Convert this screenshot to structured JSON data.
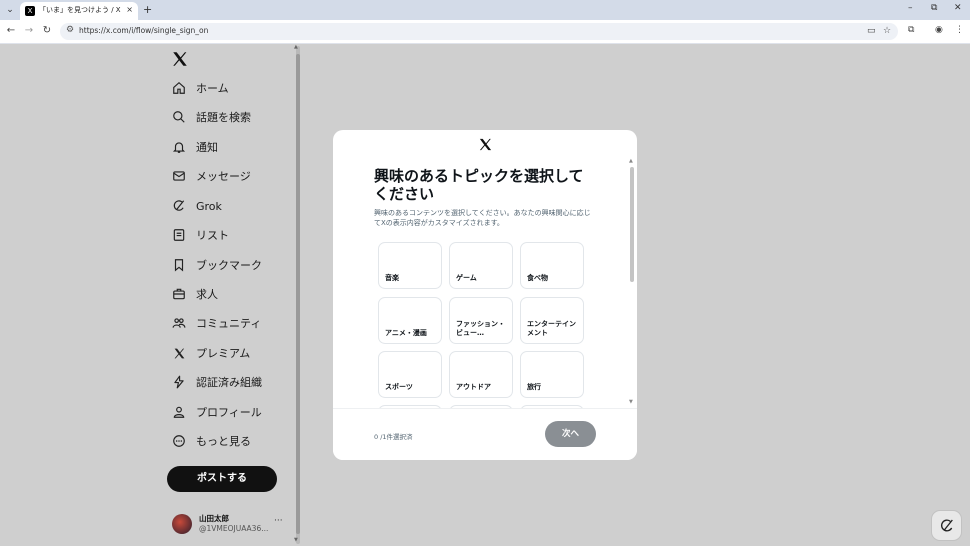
{
  "browser": {
    "tab_title": "「いま」を見つけよう / X",
    "tab_favicon": "X",
    "tab_close": "×",
    "new_tab": "+",
    "tab_menu": "⌄",
    "url": "https://x.com/i/flow/single_sign_on",
    "win_minimize": "–",
    "win_restore": "⧉",
    "win_close": "✕"
  },
  "sidebar": {
    "items": [
      {
        "label": "ホーム",
        "icon": "home-icon"
      },
      {
        "label": "話題を検索",
        "icon": "search-icon"
      },
      {
        "label": "通知",
        "icon": "bell-icon"
      },
      {
        "label": "メッセージ",
        "icon": "mail-icon"
      },
      {
        "label": "Grok",
        "icon": "grok-icon"
      },
      {
        "label": "リスト",
        "icon": "list-icon"
      },
      {
        "label": "ブックマーク",
        "icon": "bookmark-icon"
      },
      {
        "label": "求人",
        "icon": "briefcase-icon"
      },
      {
        "label": "コミュニティ",
        "icon": "people-icon"
      },
      {
        "label": "プレミアム",
        "icon": "x-icon"
      },
      {
        "label": "認証済み組織",
        "icon": "lightning-icon"
      },
      {
        "label": "プロフィール",
        "icon": "person-icon"
      },
      {
        "label": "もっと見る",
        "icon": "more-circle-icon"
      }
    ],
    "post_button": "ポストする",
    "account": {
      "name": "山田太郎",
      "handle": "@1VMEOJUAA36...",
      "more": "···"
    }
  },
  "modal": {
    "title": "興味のあるトピックを選択してください",
    "subtitle": "興味のあるコンテンツを選択してください。あなたの興味関心に応じてXの表示内容がカスタマイズされます。",
    "topics": [
      "音楽",
      "ゲーム",
      "食べ物",
      "アニメ・漫画",
      "ファッション・ビュー…",
      "エンターテインメント",
      "スポーツ",
      "アウトドア",
      "旅行"
    ],
    "selected_count": "0 /1件選択済",
    "next_button": "次へ"
  },
  "colors": {
    "backdrop": "#cfcfcf",
    "text": "#0f1419",
    "muted": "#536471",
    "next_disabled": "#8a8f94"
  }
}
